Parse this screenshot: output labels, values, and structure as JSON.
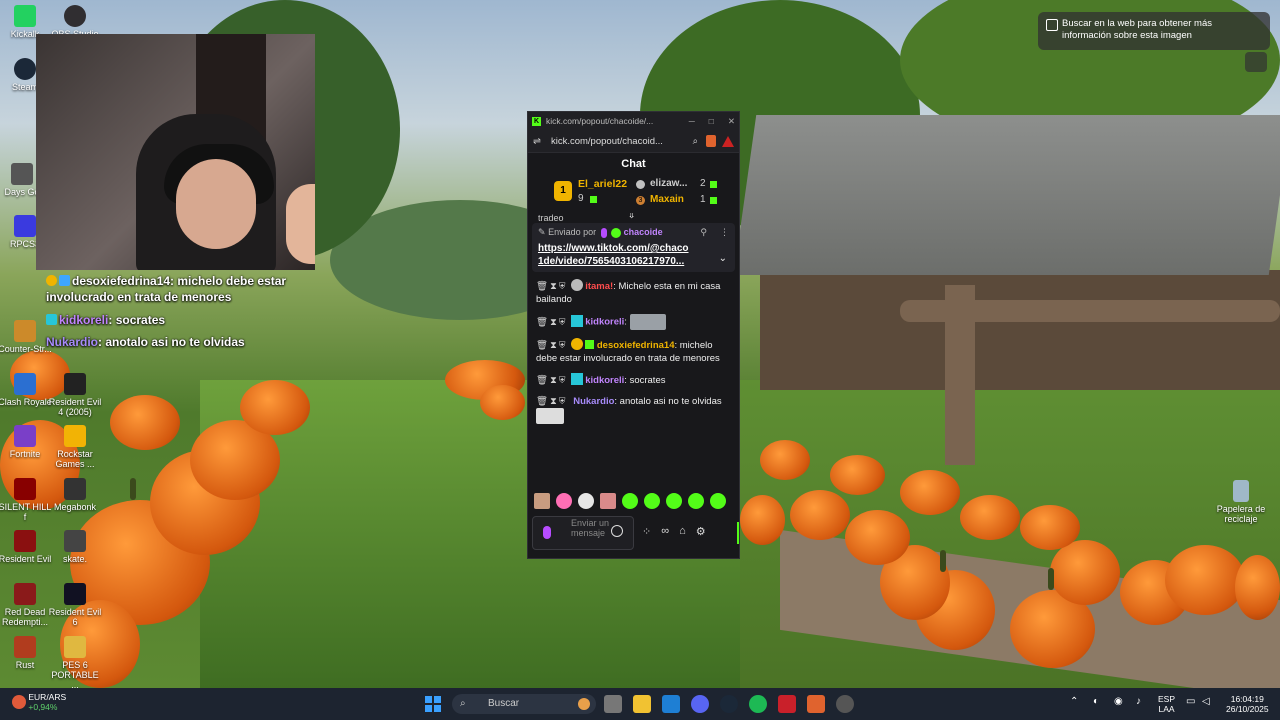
{
  "desktop": {
    "icons": [
      {
        "label": "Kickalk",
        "color": "#23d160"
      },
      {
        "label": "OBS Studio",
        "color": "#302e31"
      },
      {
        "label": "Steam",
        "color": "#1b2838"
      },
      {
        "label": "Days Go",
        "color": "#555"
      },
      {
        "label": "RPCS3",
        "color": "#3a3adf"
      },
      {
        "label": "Counter-Str...",
        "color": "#cc8a2a"
      },
      {
        "label": "Clash Royale",
        "color": "#2b6fd1"
      },
      {
        "label": "Resident Evil 4 (2005)",
        "color": "#222"
      },
      {
        "label": "Fortnite",
        "color": "#7a3fc8"
      },
      {
        "label": "Rockstar Games ...",
        "color": "#f2b305"
      },
      {
        "label": "SILENT HILL f",
        "color": "#800"
      },
      {
        "label": "Megabonk",
        "color": "#333"
      },
      {
        "label": "Resident Evil",
        "color": "#8a1010"
      },
      {
        "label": "skate.",
        "color": "#444"
      },
      {
        "label": "Red Dead Redempti...",
        "color": "#8a1a1a"
      },
      {
        "label": "Resident Evil 6",
        "color": "#112"
      },
      {
        "label": "Rust",
        "color": "#b13c1e"
      },
      {
        "label": "PES 6 PORTABLE ...",
        "color": "#e0b840"
      },
      {
        "label": "Papelera de reciclaje",
        "color": "#9fb8c8"
      }
    ]
  },
  "stream_overlay": {
    "messages": [
      {
        "user": "desoxiefedrina14",
        "text": ": michelo debe estar involucrado en trata de menores",
        "color": "#ffffff"
      },
      {
        "user": "kidkoreli",
        "text": ": socrates",
        "color": "#c084fc"
      },
      {
        "user": "Nukardio",
        "text": ": anotalo asi no te olvidas",
        "color": "#a78bfa"
      }
    ]
  },
  "lens_chip": {
    "text": "Buscar en la web para obtener más información sobre esta imagen"
  },
  "kick_window": {
    "title": "kick.com/popout/chacoide/...",
    "url": "kick.com/popout/chacoid...",
    "header": "Chat",
    "gifters": {
      "first": {
        "rank": "1",
        "name": "El_ariel22",
        "count": "9"
      },
      "second": {
        "name": "elizaw...",
        "count": "2"
      },
      "third": {
        "rank": "3",
        "name": "Maxain",
        "count": "1"
      }
    },
    "truncated_line": "tradeo",
    "pinned": {
      "label": "Enviado por",
      "user": "chacoide",
      "link_line1": "https://www.tiktok.com/@chaco",
      "link_line2": "1de/video/7565403106217970..."
    },
    "messages": [
      {
        "user": "itama!",
        "text": ": Michelo esta en mi casa bailando",
        "color": "#ff4d4d"
      },
      {
        "user": "kidkoreli",
        "text": ":",
        "color": "#c084fc"
      },
      {
        "user": "desoxiefedrina14",
        "text": ": michelo debe estar involucrado en trata de menores",
        "color": "#f0b400"
      },
      {
        "user": "kidkoreli",
        "text": ": socrates",
        "color": "#c084fc"
      },
      {
        "user": "Nukardio",
        "text": ": anotalo asi no te olvidas",
        "color": "#a78bfa"
      }
    ],
    "input_placeholder": "Enviar un mensaje"
  },
  "taskbar": {
    "ticker": {
      "pair": "EUR/ARS",
      "change": "+0,94%"
    },
    "search_placeholder": "Buscar",
    "lang": "ESP",
    "lang2": "LAA",
    "time": "16:04:19",
    "date": "26/10/2025"
  }
}
